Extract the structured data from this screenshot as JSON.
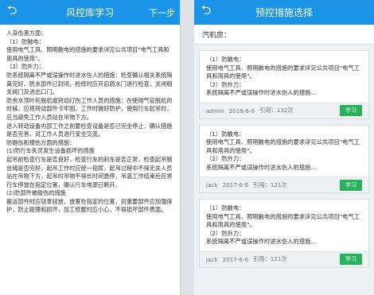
{
  "left": {
    "title": "风控库学习",
    "next_label": "下一步",
    "content": [
      "人身伤害方面：",
      "（1）防触电：",
      "使用电气工具、照明触电的措施的要求详见公共项目\"电气工具和用具的使用\"。",
      "（2）防外力：",
      "防系统隔离不严或误操作时进水伤人的措施：检查确认相关系统隔离完好、防水部件已封闭，检修时应开启疏水门进行检查，关闭相关阀门及进出口门。",
      "防余水顶叶轮脱机或转动打伤工作人员的措施：在使用气管脱机的时候，应将转动部件卡牢固，工作时做好防护，使用行车起吊时，应当避免工作人员站在吊物下方。",
      "进入转动设备内部工作之前要检查设备是否已完全停止，确认措施是否完善，对工作人员进行安全交底。",
      "防砸伤和撞伤方面的措施：",
      "(1)防行车失灵发生设备损坏的措施",
      "起吊前检查行车是否良好，检查行车的刹车是否正常，检查起吊钢丝绳是否完好，起吊工作时应统一指挥，起吊过程中不得无关人员站在吊物下方，起吊时吊物不得长时间悬停，吊装工作结束后应将行车停放在指定位置，确认行车电源已断开。",
      "(2)防部件被碰伤的措施",
      "搬运部件时应轻拿轻放，放置在指定的位置，对重要部件应加强保护，防止碰撞和损坏，加工修整时应小心，不得损坏部件表面。"
    ]
  },
  "right": {
    "title": "预控措施选择",
    "field_label": "汽机房：",
    "learn_label": "学习",
    "cards": [
      {
        "lines": [
          "（1）防触电：",
          "使用电气工具、照明触电的措施的要求详见公共项目\"电气工具和用具的使用\"。",
          "（2）防外力：",
          "系统隔离不严或误操作时进水伤人的措施..."
        ],
        "user": "admin",
        "date": "2018-6-6",
        "cite": "引用：132次"
      },
      {
        "lines": [
          "（1）防触电：",
          "使用电气工具、照明触电的措施的要求详见公共项目\"电气工具和用具的使用\"。",
          "（2）防外力：",
          "系统隔离不严或误操作时进水伤人的措施..."
        ],
        "user": "jack",
        "date": "2017-6-6",
        "cite": "引用：121次"
      },
      {
        "lines": [
          "（1）防触电：",
          "使用电气工具、照明触电的措施的要求详见公共项目\"电气工具和用具的使用\"。",
          "（2）防外力：",
          "系统隔离不严或误操作时进水伤人的措施..."
        ],
        "user": "jack",
        "date": "2017-6-6",
        "cite": "引用：121次"
      }
    ]
  }
}
